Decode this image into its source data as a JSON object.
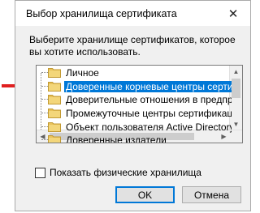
{
  "dialog": {
    "title": "Выбор хранилища сертификата",
    "close_icon": "close-icon",
    "prompt": "Выберите хранилище сертификатов, которое вы хотите использовать.",
    "stores": [
      {
        "label": "Личное",
        "selected": false
      },
      {
        "label": "Доверенные корневые центры сертифи",
        "selected": true
      },
      {
        "label": "Доверительные отношения в предприя",
        "selected": false
      },
      {
        "label": "Промежуточные центры сертификации",
        "selected": false
      },
      {
        "label": "Объект пользователя Active Directory",
        "selected": false
      },
      {
        "label": "Доверенные издатели",
        "selected": false
      }
    ],
    "show_physical_label": "Показать физические хранилища",
    "show_physical_checked": false,
    "ok_label": "OK",
    "cancel_label": "Отмена"
  },
  "annotation": {
    "arrow_color": "#e02020",
    "arrow_icon": "red-pointer-arrow-icon"
  },
  "colors": {
    "selection": "#0078d7",
    "folder": "#e8c15a"
  }
}
